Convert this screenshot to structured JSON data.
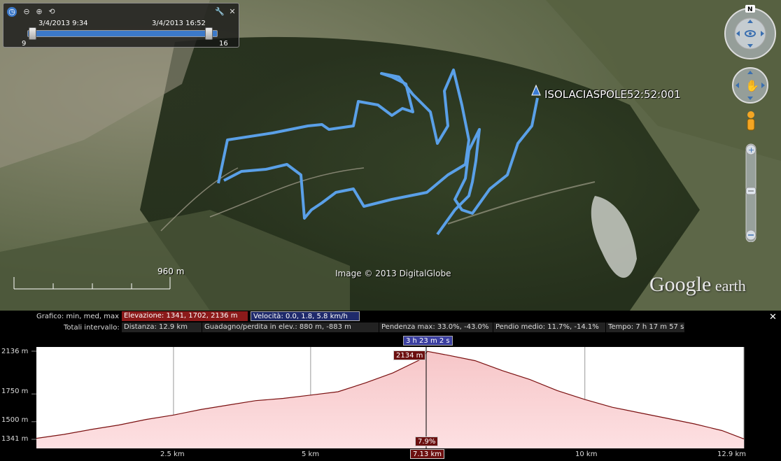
{
  "time_slider": {
    "start_label": "3/4/2013   9:34",
    "end_label": "3/4/2013   16:52",
    "start_hour": "9",
    "end_hour": "16",
    "zoom_in_label": "⊖",
    "zoom_out_label": "⊕",
    "settings_icon": "wrench-icon",
    "close_label": "✕"
  },
  "map": {
    "track_name": "ISOLACIASPOLE52:52:001",
    "attribution": "Image © 2013 DigitalGlobe",
    "logo_main": "Google",
    "logo_sub": " earth",
    "scale_label": "960 m",
    "compass_label": "N",
    "track_color": "#5aa0e8"
  },
  "profile": {
    "graph_label": "Grafico: min, med, max",
    "elevation_box": "Elevazione: 1341, 1702, 2136 m",
    "speed_box": "Velocità: 0.0, 1.8, 5.8 km/h",
    "totals_label": "Totali intervallo:",
    "distance": "Distanza: 12.9 km",
    "gain_loss": "Guadagno/perdita in elev.: 880 m, -883 m",
    "max_slope": "Pendenza max: 33.0%, -43.0%",
    "avg_slope": "Pendio medio: 11.7%, -14.1%",
    "time": "Tempo: 7 h 17 m 57 s",
    "cursor_time": "3 h 23 m 2 s",
    "cursor_elev": "2134 m",
    "cursor_slope": "7.9%",
    "cursor_dist": "7.13 km",
    "close_label": "✕",
    "elevation_color": "#8b1a1a",
    "speed_color": "#1f2a6b"
  },
  "chart_data": {
    "type": "area",
    "xlabel": "",
    "ylabel": "",
    "xlim": [
      0,
      12.9
    ],
    "ylim": [
      1341,
      2136
    ],
    "y_ticks": [
      "2136 m",
      "1750 m",
      "1500 m",
      "1341 m"
    ],
    "y_tick_values": [
      2136,
      1750,
      1500,
      1341
    ],
    "x_ticks": [
      "2.5 km",
      "5 km",
      "10 km",
      "12.9 km"
    ],
    "x_tick_values": [
      2.5,
      5,
      10,
      12.9
    ],
    "series": [
      {
        "x": [
          0,
          0.5,
          1,
          1.5,
          2,
          2.5,
          3,
          3.5,
          4,
          4.5,
          5,
          5.5,
          6,
          6.5,
          7,
          7.13,
          7.5,
          8,
          8.5,
          9,
          9.5,
          10,
          10.5,
          11,
          11.5,
          12,
          12.5,
          12.9
        ],
        "y": [
          1350,
          1385,
          1430,
          1470,
          1520,
          1560,
          1610,
          1650,
          1690,
          1710,
          1740,
          1770,
          1850,
          1940,
          2060,
          2134,
          2100,
          2050,
          1960,
          1880,
          1780,
          1700,
          1630,
          1580,
          1530,
          1480,
          1420,
          1345
        ]
      }
    ]
  }
}
